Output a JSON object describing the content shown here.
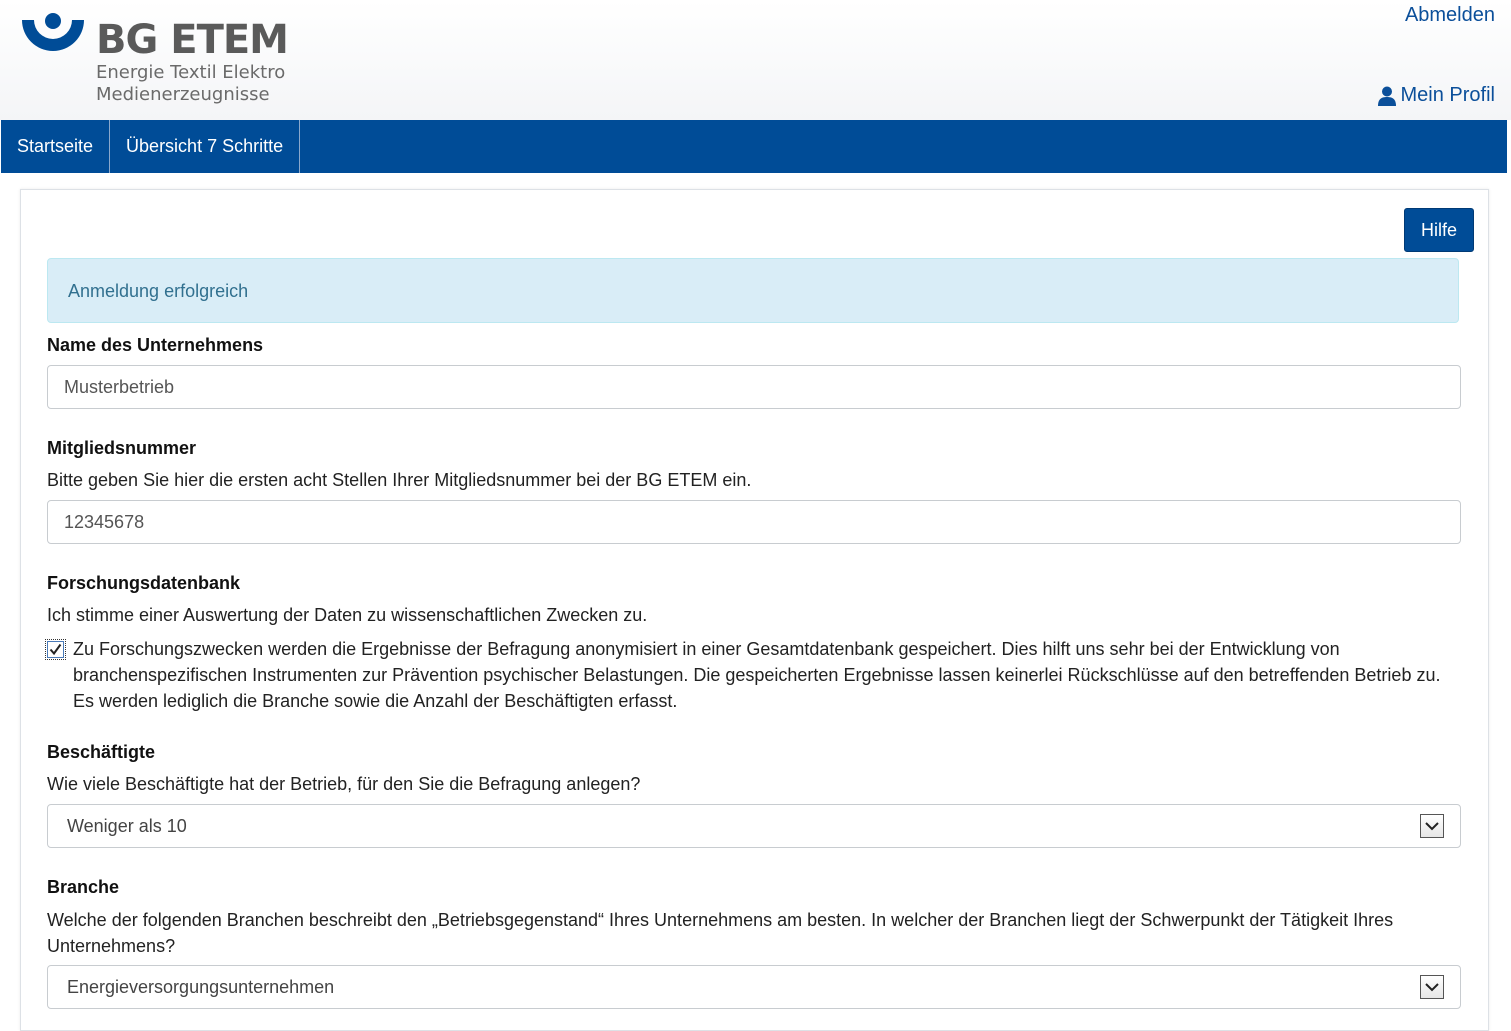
{
  "header": {
    "logo": {
      "title": "BG ETEM",
      "subtitle_line1": "Energie Textil Elektro",
      "subtitle_line2": "Medienerzeugnisse"
    },
    "logout_label": "Abmelden",
    "profile_label": "Mein Profil",
    "profile_icon": "user-icon"
  },
  "nav": {
    "items": [
      {
        "label": "Startseite"
      },
      {
        "label": "Übersicht 7 Schritte"
      }
    ]
  },
  "main": {
    "help_label": "Hilfe",
    "alert_text": "Anmeldung erfolgreich",
    "company": {
      "label": "Name des Unternehmens",
      "value": "Musterbetrieb"
    },
    "member": {
      "label": "Mitgliedsnummer",
      "description": "Bitte geben Sie hier die ersten acht Stellen Ihrer Mitgliedsnummer bei der BG ETEM ein.",
      "value": "12345678"
    },
    "research": {
      "label": "Forschungsdatenbank",
      "description": "Ich stimme einer Auswertung der Daten zu wissenschaftlichen Zwecken zu.",
      "checkbox_checked": true,
      "checkbox_text": "Zu Forschungszwecken werden die Ergebnisse der Befragung anonymisiert in einer Gesamtdatenbank gespeichert. Dies hilft uns sehr bei der Entwicklung von branchenspezifischen Instrumenten zur Prävention psychischer Belastungen. Die gespeicherten Ergebnisse lassen keinerlei Rückschlüsse auf den betreffenden Betrieb zu. Es werden lediglich die Branche sowie die Anzahl der Beschäftigten erfasst."
    },
    "employees": {
      "label": "Beschäftigte",
      "description": "Wie viele Beschäftigte hat der Betrieb, für den Sie die Befragung anlegen?",
      "selected": "Weniger als 10"
    },
    "industry": {
      "label": "Branche",
      "description": "Welche der folgenden Branchen beschreibt den „Betriebsgegenstand“ Ihres Unternehmens am besten. In welcher der Branchen liegt der Schwerpunkt der Tätigkeit Ihres Unternehmens?",
      "selected": "Energieversorgungsunternehmen"
    }
  },
  "colors": {
    "brand_blue": "#004c97",
    "link_blue": "#0b4f9a",
    "alert_bg": "#d9edf7",
    "alert_text": "#31708f"
  }
}
